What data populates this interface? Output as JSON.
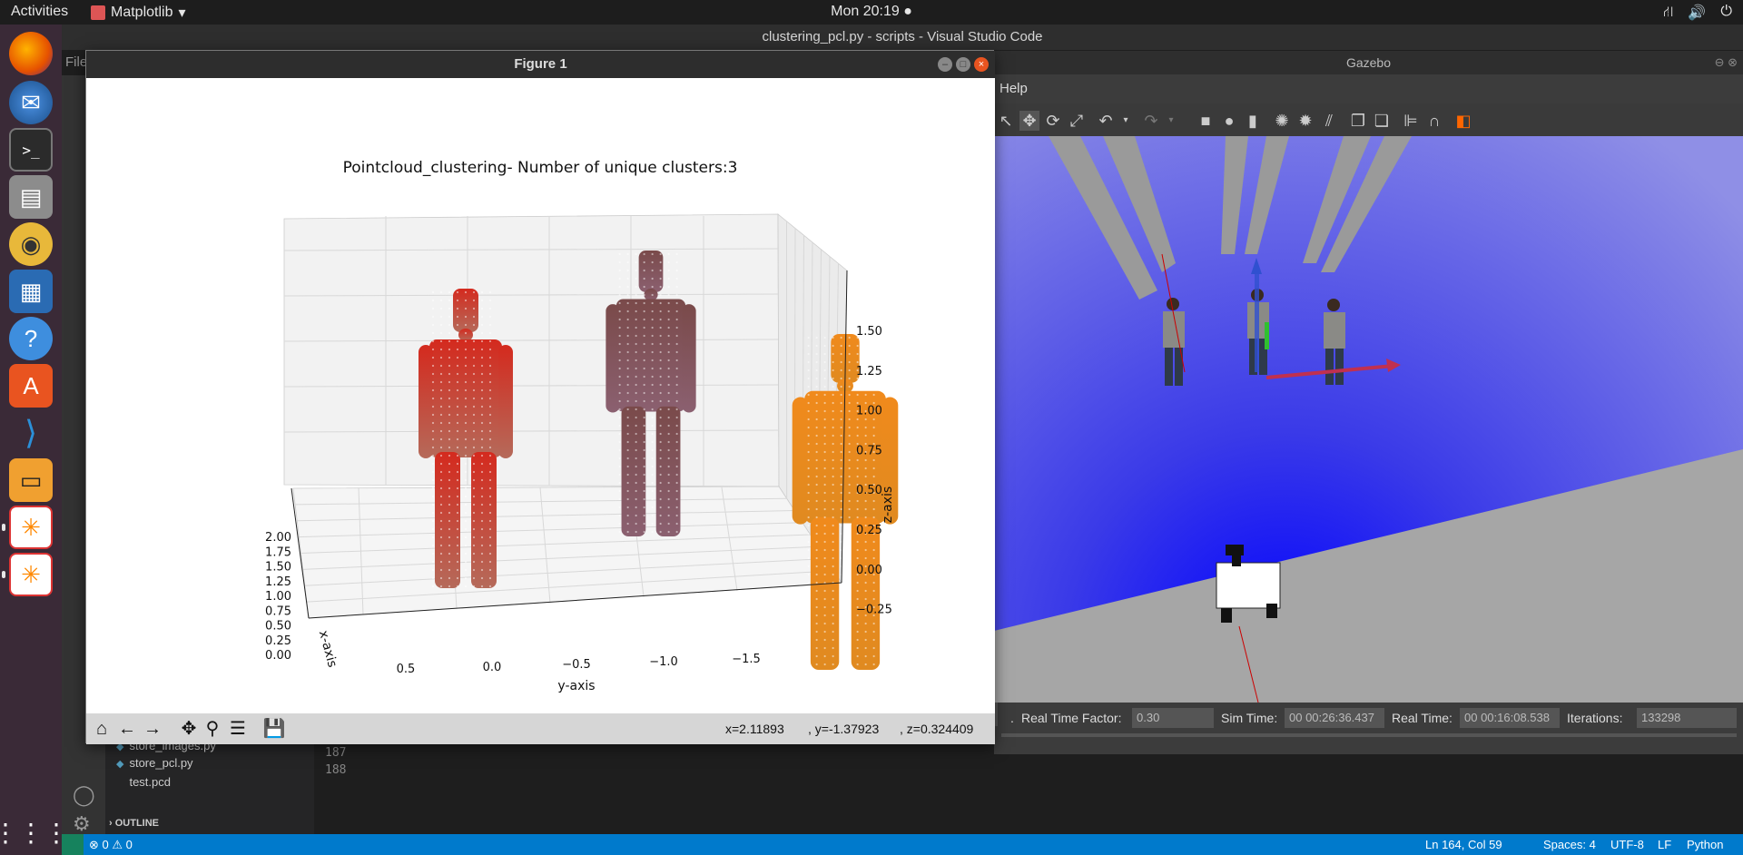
{
  "topbar": {
    "activities": "Activities",
    "app_name": "Matplotlib",
    "clock": "Mon 20:19 ●",
    "tray": [
      "⛙",
      "🔊",
      "⏻"
    ]
  },
  "dock": {
    "items": [
      "firefox-icon",
      "thunderbird-icon",
      "terminal-icon",
      "files-icon",
      "rhythmbox-icon",
      "libreoffice-writer-icon",
      "help-icon",
      "software-center-icon",
      "vscode-icon",
      "ros-book-icon",
      "rviz-icon",
      "rviz-icon-2",
      "app-grid-icon"
    ]
  },
  "vscode": {
    "title": "clustering_pcl.py - scripts - Visual Studio Code",
    "menu_first": "File",
    "files": [
      "store_images.py",
      "store_pcl.py",
      "test.pcd"
    ],
    "outline_label": "OUTLINE",
    "line_numbers": [
      "187",
      "188"
    ],
    "status": {
      "errors": "⊗ 0 ⚠ 0",
      "position": "Ln 164, Col 59",
      "spaces": "Spaces: 4",
      "encoding": "UTF-8",
      "eol": "LF",
      "language": "Python"
    }
  },
  "gazebo": {
    "title": "Gazebo",
    "menu_help": "Help",
    "status": {
      "rtf_label": "Real Time Factor:",
      "rtf_value": "0.30",
      "sim_label": "Sim Time:",
      "sim_value": "00 00:26:36.437",
      "real_label": "Real Time:",
      "real_value": "00 00:16:08.538",
      "iter_label": "Iterations:",
      "iter_value": "133298"
    }
  },
  "figure": {
    "window_title": "Figure 1",
    "coords": {
      "x": "x=2.11893",
      "y": ", y=-1.37923",
      "z": ", z=0.324409"
    }
  },
  "chart_data": {
    "type": "scatter",
    "title": "Pointcloud_clustering- Number of unique clusters:3",
    "xlabel": "x-axis",
    "ylabel": "y-axis",
    "zlabel": "z-axis",
    "x_ticks": [
      "0.00",
      "0.25",
      "0.50",
      "0.75",
      "1.00",
      "1.25",
      "1.50",
      "1.75",
      "2.00"
    ],
    "y_ticks": [
      "0.5",
      "0.0",
      "−0.5",
      "−1.0",
      "−1.5"
    ],
    "z_ticks": [
      "1.50",
      "1.25",
      "1.00",
      "0.75",
      "0.50",
      "0.25",
      "0.00",
      "−0.25"
    ],
    "grid": true,
    "series": [
      {
        "color": "#d42a1e",
        "color_bottom": "#b56a5a",
        "y_center": 0.6
      },
      {
        "color": "#7a4a4a",
        "color_bottom": "#8b6070",
        "y_center": 0.1
      },
      {
        "color": "#f08a1c",
        "color_bottom": "#e08a20",
        "y_center": -1.3
      }
    ]
  }
}
